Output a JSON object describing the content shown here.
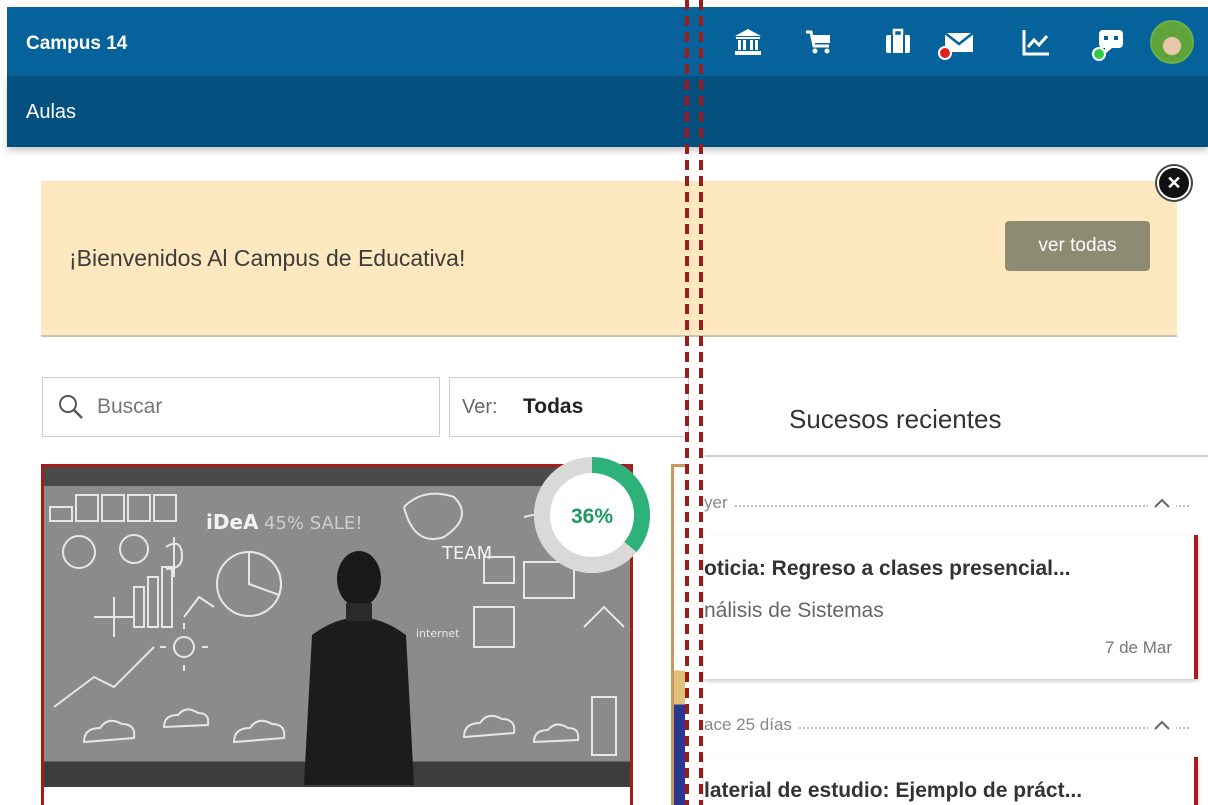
{
  "header": {
    "app_title": "Campus 14",
    "section_title": "Aulas",
    "icons": [
      "bank-icon",
      "cart-icon",
      "briefcase-icon",
      "mail-icon",
      "chart-icon",
      "chat-bot-icon"
    ],
    "mail_notification_color": "#e02020",
    "chat_status_color": "#2ecc40",
    "bar_color": "#06629b",
    "subbar_color": "#04507f"
  },
  "announcement": {
    "text": "¡Bienvenidos Al Campus de Educativa!",
    "button_label": "ver todas",
    "background_color": "#fde8bf"
  },
  "filters": {
    "search_placeholder": "Buscar",
    "view_label": "Ver:",
    "view_value": "Todas"
  },
  "course_card": {
    "progress_percent": 36,
    "progress_label": "36%",
    "progress_color": "#2db37a",
    "accent_color": "#a91b1b",
    "chalk_words": [
      "iDeA",
      "TEAM",
      "internet"
    ]
  },
  "recent_events": {
    "title": "Sucesos recientes",
    "groups": [
      {
        "label": "yer",
        "items": [
          {
            "title": "oticia: Regreso a clases presencial...",
            "subtitle": "nálisis de Sistemas",
            "date": "7 de Mar"
          }
        ]
      },
      {
        "label": "ace 25 días",
        "items": [
          {
            "title": "laterial de estudio: Ejemplo de práct..."
          }
        ]
      }
    ]
  }
}
